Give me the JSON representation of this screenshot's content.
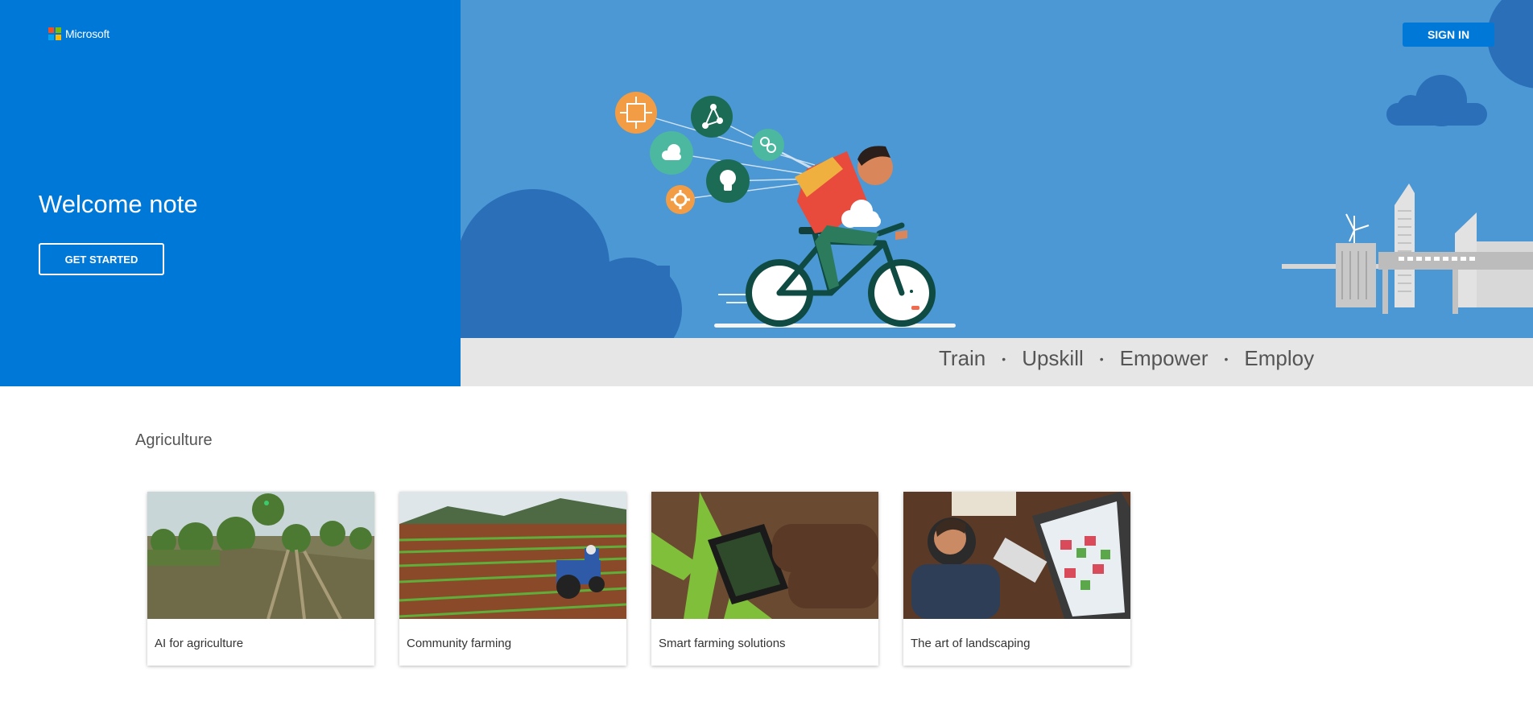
{
  "brand": {
    "name": "Microsoft",
    "logo_colors": [
      "#f25022",
      "#7fba00",
      "#00a4ef",
      "#ffb900"
    ]
  },
  "hero": {
    "title": "Welcome note",
    "cta_label": "GET STARTED",
    "sign_in_label": "SIGN IN",
    "tagline": [
      "Train",
      "Upskill",
      "Empower",
      "Employ"
    ],
    "tagline_separator": "•",
    "skill_icons": [
      "circuit-icon",
      "network-icon",
      "cloud-icon",
      "link-icon",
      "lightbulb-icon",
      "gear-icon"
    ]
  },
  "section": {
    "title": "Agriculture",
    "cards": [
      {
        "label": "AI for agriculture",
        "image": "field-photo"
      },
      {
        "label": "Community farming",
        "image": "tractor-photo"
      },
      {
        "label": "Smart farming solutions",
        "image": "phone-crop-photo"
      },
      {
        "label": "The art of landscaping",
        "image": "designer-screen-photo"
      }
    ]
  },
  "colors": {
    "primary_blue": "#0078d7",
    "hero_blue": "#4b98d4",
    "tagline_bg": "#e6e6e6"
  }
}
